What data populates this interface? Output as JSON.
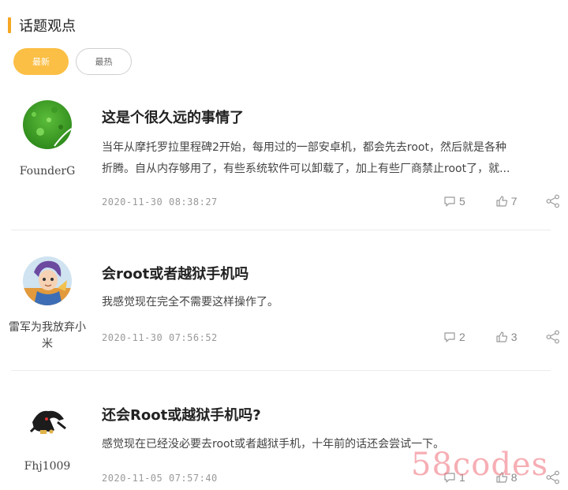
{
  "section": {
    "title": "话题观点"
  },
  "tabs": [
    {
      "label": "最新",
      "active": true
    },
    {
      "label": "最热",
      "active": false
    }
  ],
  "posts": [
    {
      "author": "FounderG",
      "title": "这是个很久远的事情了",
      "excerpt_lines": [
        "当年从摩托罗拉里程碑2开始，每用过的一部安卓机，都会先去root，然后就是各种",
        "折腾。自从内存够用了，有些系统软件可以卸载了，加上有些厂商禁止root了，就..."
      ],
      "date": "2020-11-30 08:38:27",
      "comments": "5",
      "likes": "7"
    },
    {
      "author": "雷军为我放弃小米",
      "title": "会root或者越狱手机吗",
      "excerpt_lines": [
        "我感觉现在完全不需要这样操作了。"
      ],
      "date": "2020-11-30 07:56:52",
      "comments": "2",
      "likes": "3"
    },
    {
      "author": "Fhj1009",
      "title": "还会Root或越狱手机吗?",
      "excerpt_lines": [
        "感觉现在已经没必要去root或者越狱手机，十年前的话还会尝试一下。"
      ],
      "date": "2020-11-05 07:57:40",
      "comments": "1",
      "likes": "8"
    }
  ],
  "watermark": "58codes",
  "colors": {
    "accent": "#fbbf45",
    "header_bar": "#f5a623",
    "muted": "#999999"
  },
  "icons": {
    "comment": "comment-icon",
    "like": "thumbs-up-icon",
    "share": "share-icon"
  }
}
